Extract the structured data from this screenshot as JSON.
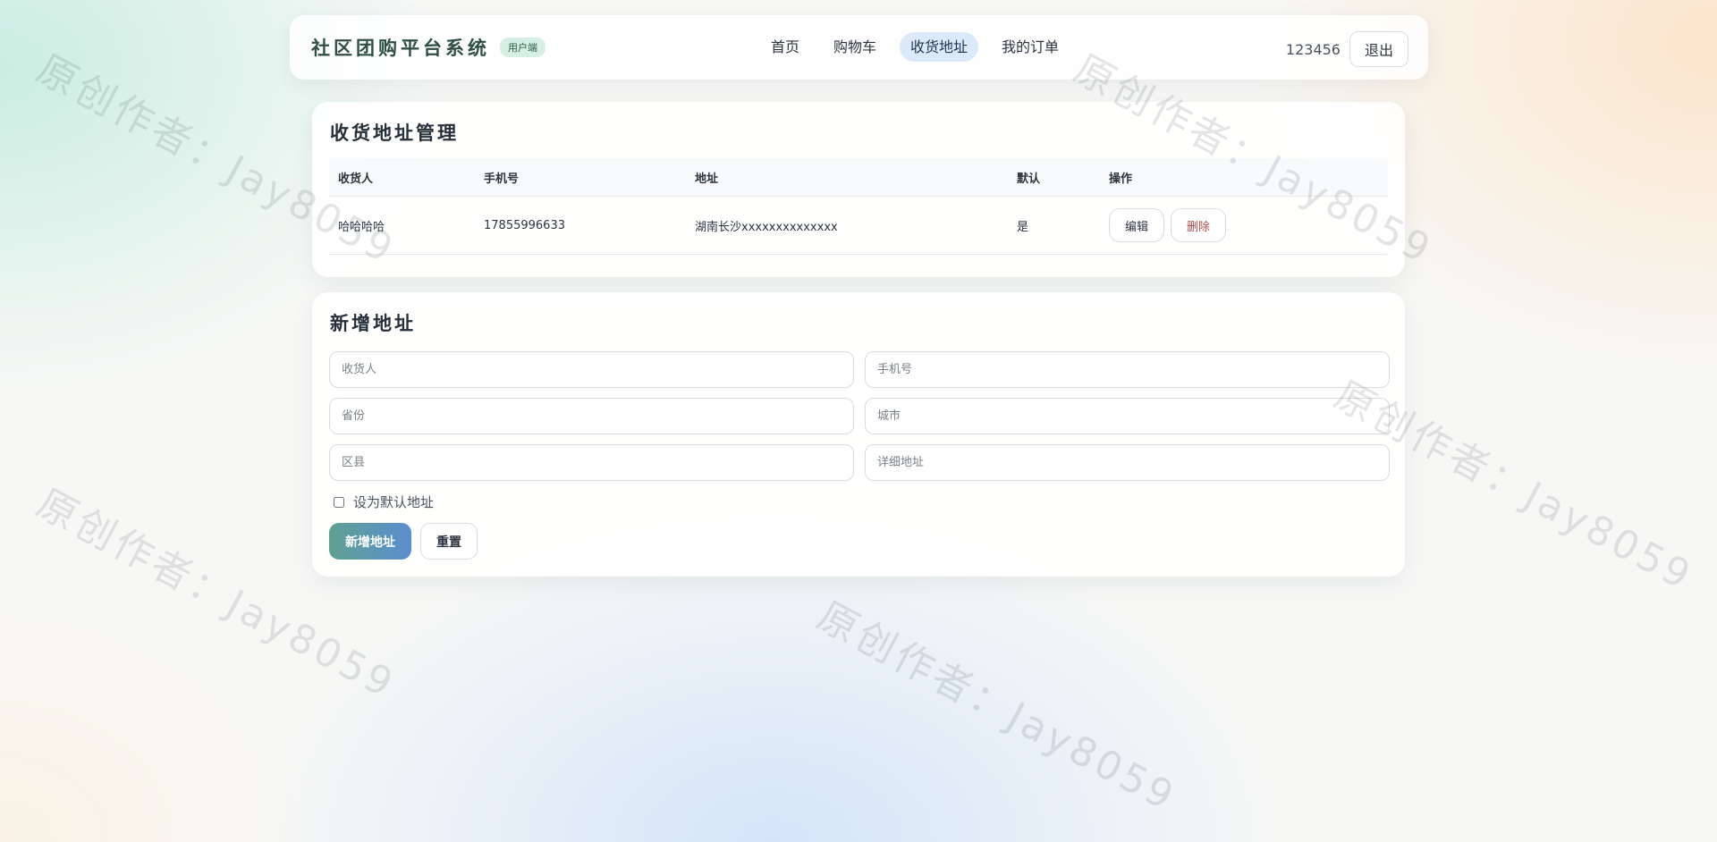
{
  "header": {
    "title": "社区团购平台系统",
    "badge": "用户端",
    "nav": [
      {
        "label": "首页",
        "active": false
      },
      {
        "label": "购物车",
        "active": false
      },
      {
        "label": "收货地址",
        "active": true
      },
      {
        "label": "我的订单",
        "active": false
      }
    ],
    "username": "123456",
    "logout_label": "退出"
  },
  "address_list": {
    "title": "收货地址管理",
    "columns": [
      "收货人",
      "手机号",
      "地址",
      "默认",
      "操作"
    ],
    "rows": [
      {
        "name": "哈哈哈哈",
        "phone": "17855996633",
        "address": "湖南长沙xxxxxxxxxxxxxx",
        "is_default": "是",
        "edit_label": "编辑",
        "delete_label": "删除"
      }
    ]
  },
  "new_address": {
    "title": "新增地址",
    "fields": {
      "receiver": {
        "placeholder": "收货人",
        "value": ""
      },
      "phone": {
        "placeholder": "手机号",
        "value": ""
      },
      "province": {
        "placeholder": "省份",
        "value": ""
      },
      "city": {
        "placeholder": "城市",
        "value": ""
      },
      "district": {
        "placeholder": "区县",
        "value": ""
      },
      "detail": {
        "placeholder": "详细地址",
        "value": ""
      }
    },
    "default_checkbox_label": "设为默认地址",
    "default_checked": false,
    "submit_label": "新增地址",
    "reset_label": "重置"
  },
  "watermark": "原创作者：Jay8059",
  "colors": {
    "accent_active_nav": "#dbe9fb",
    "badge_bg": "#d6efe4",
    "danger": "#b84a4a",
    "submit_gradient_start": "#5fa192",
    "submit_gradient_end": "#5b8ed0"
  }
}
